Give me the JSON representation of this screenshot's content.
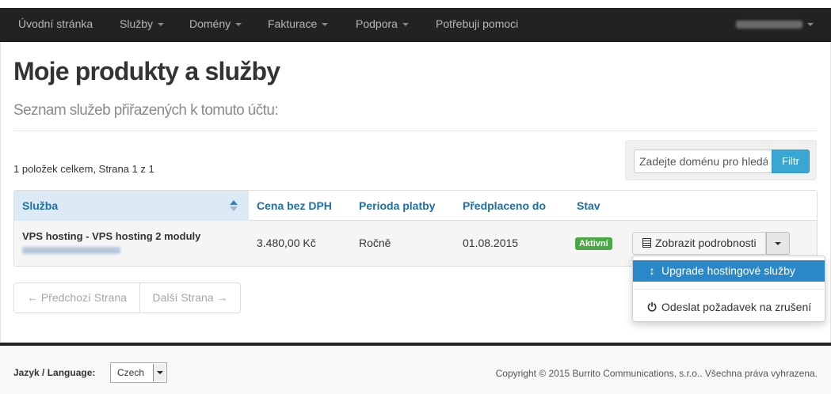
{
  "nav": {
    "items": [
      {
        "label": "Úvodní stránka",
        "dropdown": false
      },
      {
        "label": "Služby",
        "dropdown": true
      },
      {
        "label": "Domény",
        "dropdown": true
      },
      {
        "label": "Fakturace",
        "dropdown": true
      },
      {
        "label": "Podpora",
        "dropdown": true
      },
      {
        "label": "Potřebuji pomoci",
        "dropdown": false
      }
    ]
  },
  "page": {
    "title": "Moje produkty a služby",
    "subtitle": "Seznam služeb přiřazených k tomuto účtu:"
  },
  "summary": {
    "count_text": "1 položek celkem, Strana 1 z 1"
  },
  "filter": {
    "placeholder": "Zadejte doménu pro hledání",
    "button_label": "Filtr"
  },
  "table": {
    "headers": [
      "Služba",
      "Cena bez DPH",
      "Perioda platby",
      "Předplaceno do",
      "Stav"
    ],
    "rows": [
      {
        "service": "VPS hosting - VPS hosting 2 moduly",
        "price": "3.480,00 Kč",
        "period": "Ročně",
        "paid_until": "01.08.2015",
        "status": "Aktivní",
        "action_label": "Zobrazit podrobnosti"
      }
    ]
  },
  "actions_menu": {
    "items": [
      {
        "label": "Upgrade hostingové služby",
        "icon": "resize-vertical-icon"
      },
      {
        "label": "Odeslat požadavek na zrušení",
        "icon": "power-icon"
      }
    ]
  },
  "pagination": {
    "prev_label": "← Předchozí Strana",
    "next_label": "Další Strana →"
  },
  "footer": {
    "language_label": "Jazyk / Language:",
    "language_value": "Czech",
    "copyright": "Copyright © 2015 Burrito Communications, s.r.o.. Všechna práva vyhrazena."
  },
  "colors": {
    "navbar": "#222222",
    "link": "#1d6fa6",
    "accent": "#2a88c9",
    "filter_button": "#39a7d4",
    "status_active": "#4aa846"
  }
}
